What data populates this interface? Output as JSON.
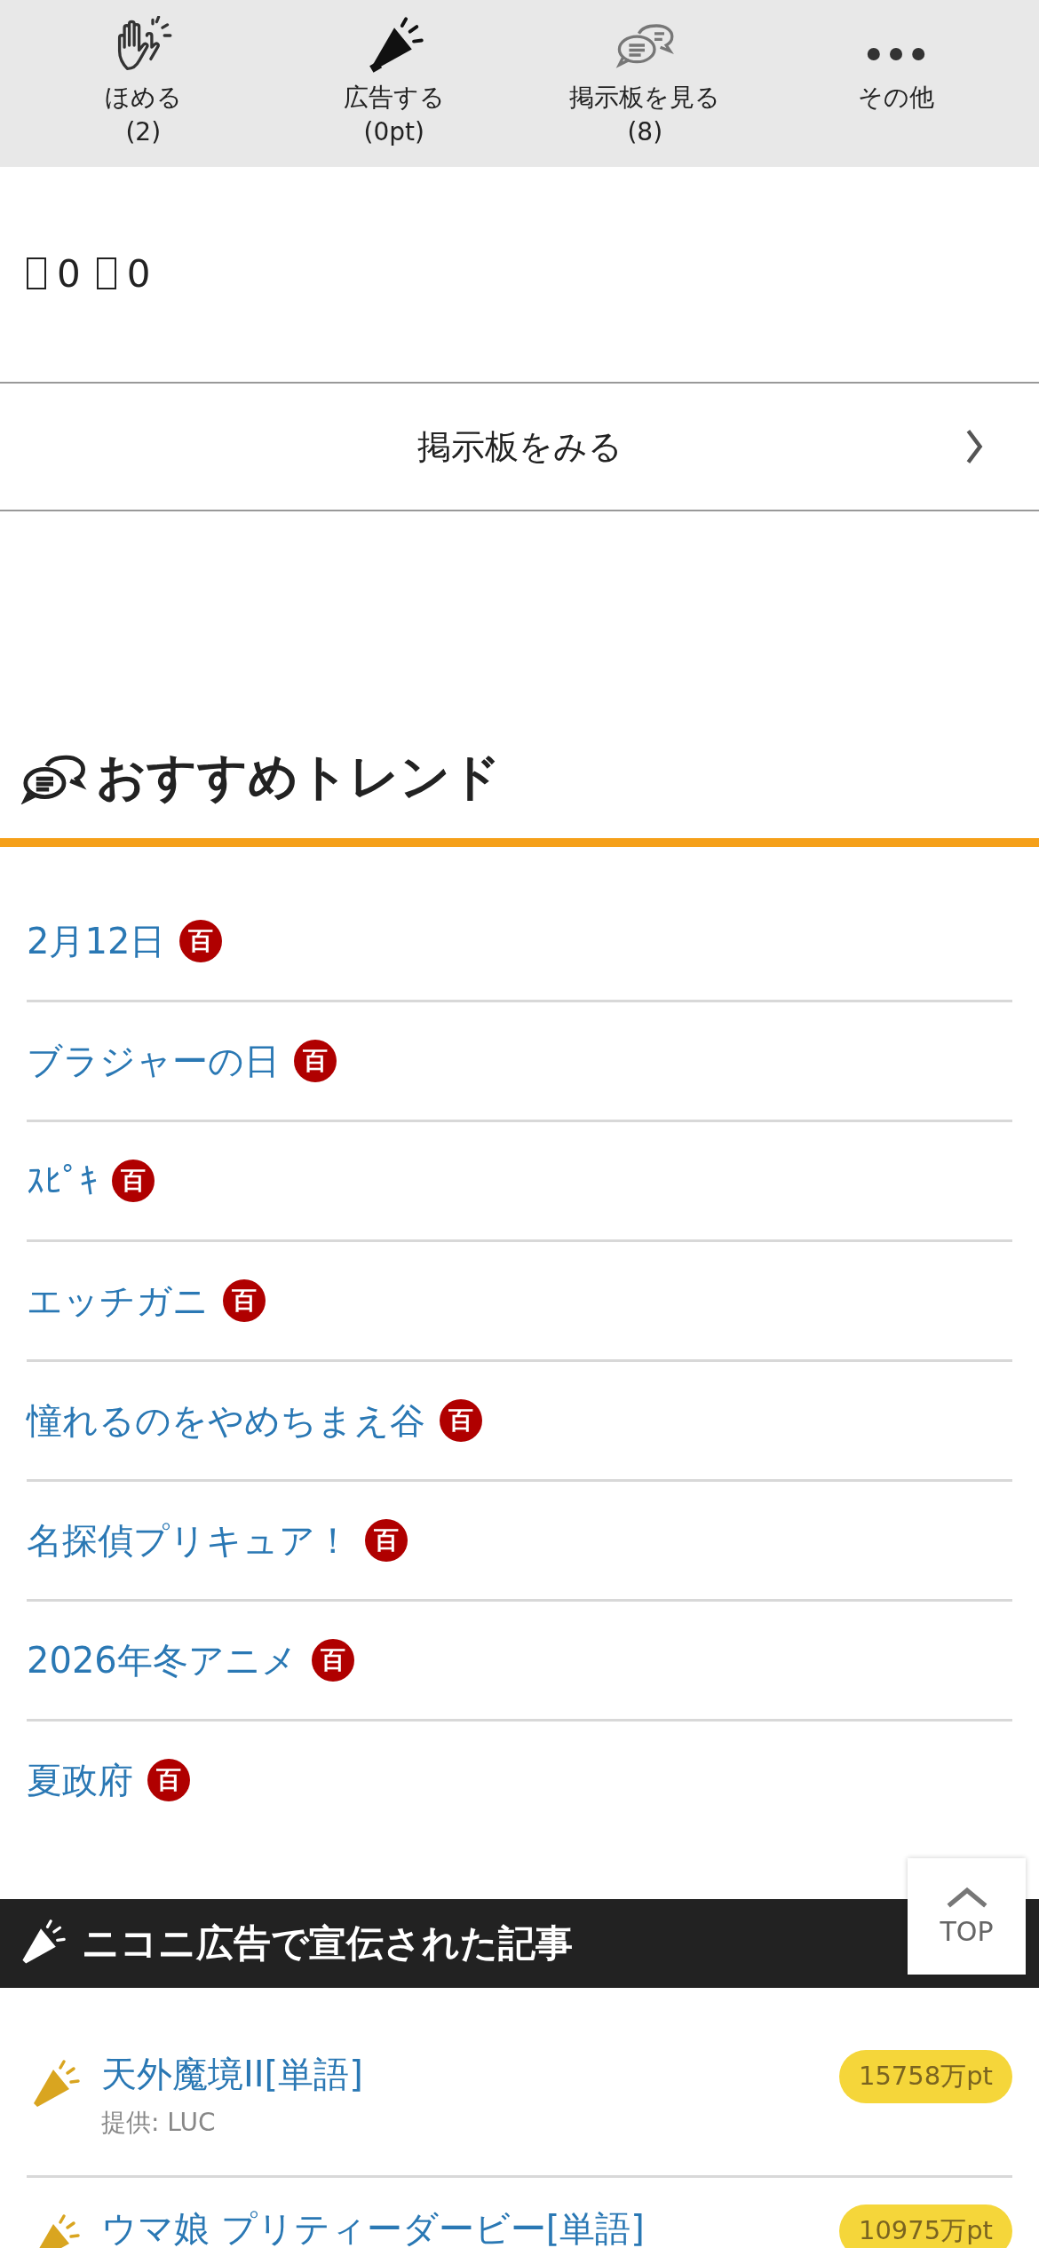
{
  "action_bar": [
    {
      "kind": "clap",
      "label": "ほめる",
      "count": "(2)"
    },
    {
      "kind": "megaphone",
      "label": "広告する",
      "count": "(0pt)"
    },
    {
      "kind": "chat",
      "label": "掲示板を見る",
      "count": "(8)"
    },
    {
      "kind": "more",
      "label": "その他"
    }
  ],
  "reactions": [
    {
      "count": "0"
    },
    {
      "count": "0"
    }
  ],
  "board_link": {
    "label": "掲示板をみる"
  },
  "trends": {
    "title": "おすすめトレンド",
    "items": [
      {
        "label": "2月12日",
        "badge": "百"
      },
      {
        "label": "ブラジャーの日",
        "badge": "百"
      },
      {
        "label": "ｽﾋﾟｷ",
        "badge": "百"
      },
      {
        "label": "エッチガニ",
        "badge": "百"
      },
      {
        "label": "憧れるのをやめちまえ谷",
        "badge": "百"
      },
      {
        "label": "名探偵プリキュア！",
        "badge": "百"
      },
      {
        "label": "2026年冬アニメ",
        "badge": "百"
      },
      {
        "label": "夏政府",
        "badge": "百"
      }
    ]
  },
  "top_button": {
    "label": "TOP"
  },
  "ads": {
    "title": "ニコニ広告で宣伝された記事",
    "items": [
      {
        "title": "天外魔境II[単語]",
        "sponsor": "提供: LUC",
        "points": "15758万pt"
      },
      {
        "title": "ウマ娘 プリティーダービー[単語]",
        "points": "10975万pt"
      }
    ]
  }
}
